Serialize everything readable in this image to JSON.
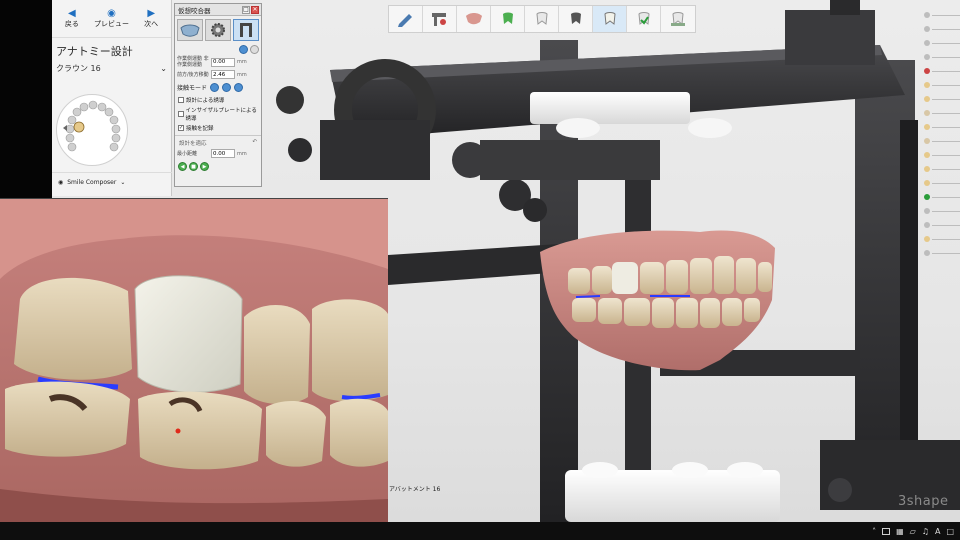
{
  "colors": {
    "accent": "#1f6fc0",
    "gum": "#c98a86",
    "tooth": "#e8dcc0",
    "crown": "#efeee4",
    "contact": "#2a3cff",
    "metal": "#2b2b2d"
  },
  "toolbar": {
    "icons": [
      "pencil-tool-icon",
      "articulator-tool-icon",
      "jaw-tool-icon",
      "tooth-scan-icon",
      "tooth-white-icon",
      "tooth-dark-icon",
      "tooth-crown-icon",
      "tooth-green-icon",
      "tooth-settings-icon"
    ],
    "active_index": 6
  },
  "anatomy_panel": {
    "nav": {
      "back": "戻る",
      "preview": "プレビュー",
      "next": "次へ"
    },
    "title": "アナトミー設計",
    "crown_label": "クラウン 16",
    "smile_composer": "Smile Composer"
  },
  "articulator": {
    "title": "仮想咬合器",
    "fields": [
      {
        "label": "作業側運動 非作業側運動",
        "value": "0.00",
        "unit": "mm"
      },
      {
        "label": "前方/後方移動",
        "value": "2.46",
        "unit": "mm"
      }
    ],
    "mode_label": "接触モード",
    "checks": [
      {
        "label": "設計による誘導",
        "checked": false
      },
      {
        "label": "インサイザルプレートによる誘導",
        "checked": false
      },
      {
        "label": "接触を記録",
        "checked": true
      }
    ],
    "apply_label": "設計を適応",
    "min_distance": {
      "label": "最小距離",
      "value": "0.00",
      "unit": "mm"
    }
  },
  "abutment_label": "アバットメント 16",
  "brand": "3shape",
  "taskbar": {
    "ime": "A"
  }
}
